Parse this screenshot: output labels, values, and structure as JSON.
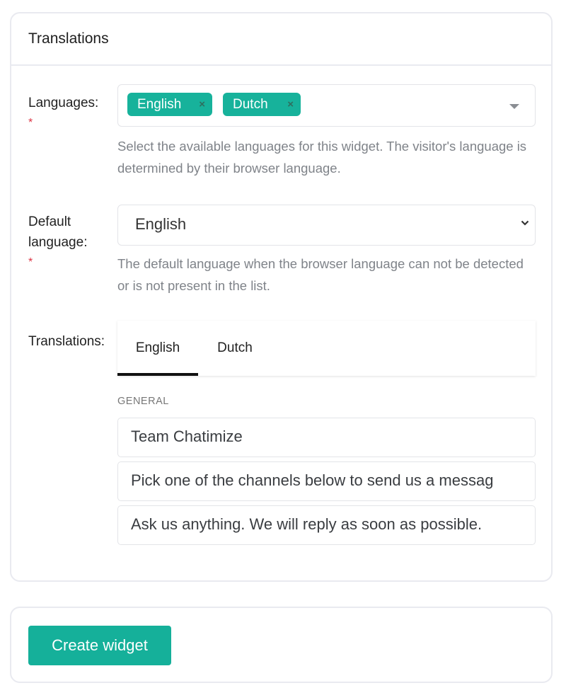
{
  "card": {
    "title": "Translations"
  },
  "languages": {
    "label": "Languages:",
    "required_mark": "*",
    "selected": [
      {
        "label": "English",
        "remove": "×"
      },
      {
        "label": "Dutch",
        "remove": "×"
      }
    ],
    "help": "Select the available languages for this widget. The visitor's language is determined by their browser language."
  },
  "default_language": {
    "label": "Default language:",
    "required_mark": "*",
    "value": "English",
    "help": "The default language when the browser language can not be detected or is not present in the list."
  },
  "translations": {
    "label": "Translations:",
    "tabs": [
      {
        "label": "English",
        "active": true
      },
      {
        "label": "Dutch",
        "active": false
      }
    ],
    "section": "GENERAL",
    "fields": [
      {
        "value": "Team Chatimize"
      },
      {
        "value": "Pick one of the channels below to send us a messag"
      },
      {
        "value": "Ask us anything. We will reply as soon as possible."
      }
    ]
  },
  "actions": {
    "create_label": "Create widget"
  },
  "colors": {
    "accent": "#17b29b",
    "required": "#dc3545",
    "border": "#e9eaf0"
  }
}
